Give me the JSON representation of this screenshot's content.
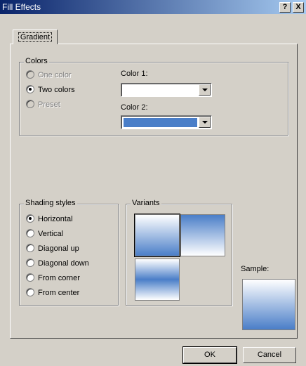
{
  "window": {
    "title": "Fill Effects",
    "help_label": "?",
    "close_label": "X"
  },
  "tabs": [
    {
      "label": "Gradient",
      "selected": true
    }
  ],
  "colors": {
    "group_label": "Colors",
    "options": [
      {
        "label": "One color",
        "checked": false,
        "enabled": false
      },
      {
        "label": "Two colors",
        "checked": true,
        "enabled": true
      },
      {
        "label": "Preset",
        "checked": false,
        "enabled": false
      }
    ],
    "color1": {
      "label": "Color 1:",
      "value_color": "#ffffff"
    },
    "color2": {
      "label": "Color 2:",
      "value_color": "#4a7ec8"
    }
  },
  "shading": {
    "group_label": "Shading styles",
    "options": [
      {
        "label": "Horizontal",
        "checked": true
      },
      {
        "label": "Vertical",
        "checked": false
      },
      {
        "label": "Diagonal up",
        "checked": false
      },
      {
        "label": "Diagonal down",
        "checked": false
      },
      {
        "label": "From corner",
        "checked": false
      },
      {
        "label": "From center",
        "checked": false
      }
    ]
  },
  "variants": {
    "group_label": "Variants",
    "selected_index": 0
  },
  "sample": {
    "label": "Sample:"
  },
  "buttons": {
    "ok": "OK",
    "cancel": "Cancel"
  },
  "colors_palette": {
    "titlebar_start": "#0a246a",
    "gradient_blue": "#4a7ec8",
    "face": "#d4d0c8"
  }
}
